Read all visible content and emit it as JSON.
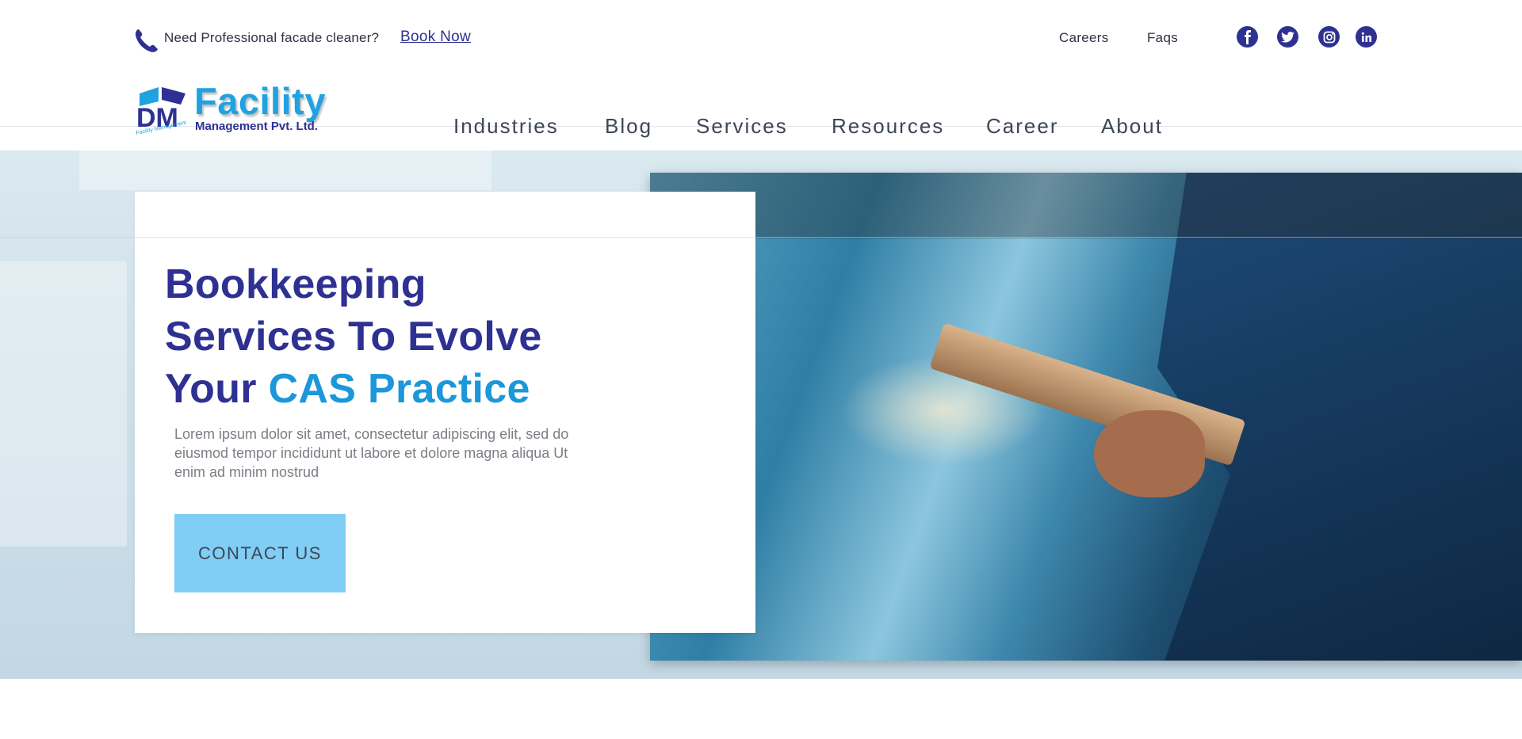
{
  "topbar": {
    "promo_text": "Need Professional facade cleaner?",
    "book_link": "Book Now",
    "links": [
      "Careers",
      "Faqs"
    ],
    "social_icons": [
      "facebook-icon",
      "twitter-icon",
      "instagram-icon",
      "linkedin-icon"
    ]
  },
  "logo": {
    "initials": "DM",
    "word": "Facility",
    "subtitle": "Management Pvt. Ltd.",
    "tagline": "Facility Management"
  },
  "nav": {
    "items": [
      "Industries",
      "Blog",
      "Services",
      "Resources",
      "Career",
      "About"
    ]
  },
  "hero": {
    "title_line1": "Bookkeeping",
    "title_line2": "Services To Evolve",
    "title_line3_prefix": "Your ",
    "title_line3_accent": "CAS Practice",
    "description": "Lorem ipsum dolor sit amet, consectetur adipiscing elit, sed do eiusmod tempor incididunt ut labore et dolore magna aliqua Ut enim ad minim nostrud",
    "cta_label": "CONTACT US"
  },
  "colors": {
    "brand_navy": "#2e3192",
    "brand_blue": "#1b97da",
    "cta_bg": "#80cdf5",
    "nav_text": "#3e4655"
  }
}
